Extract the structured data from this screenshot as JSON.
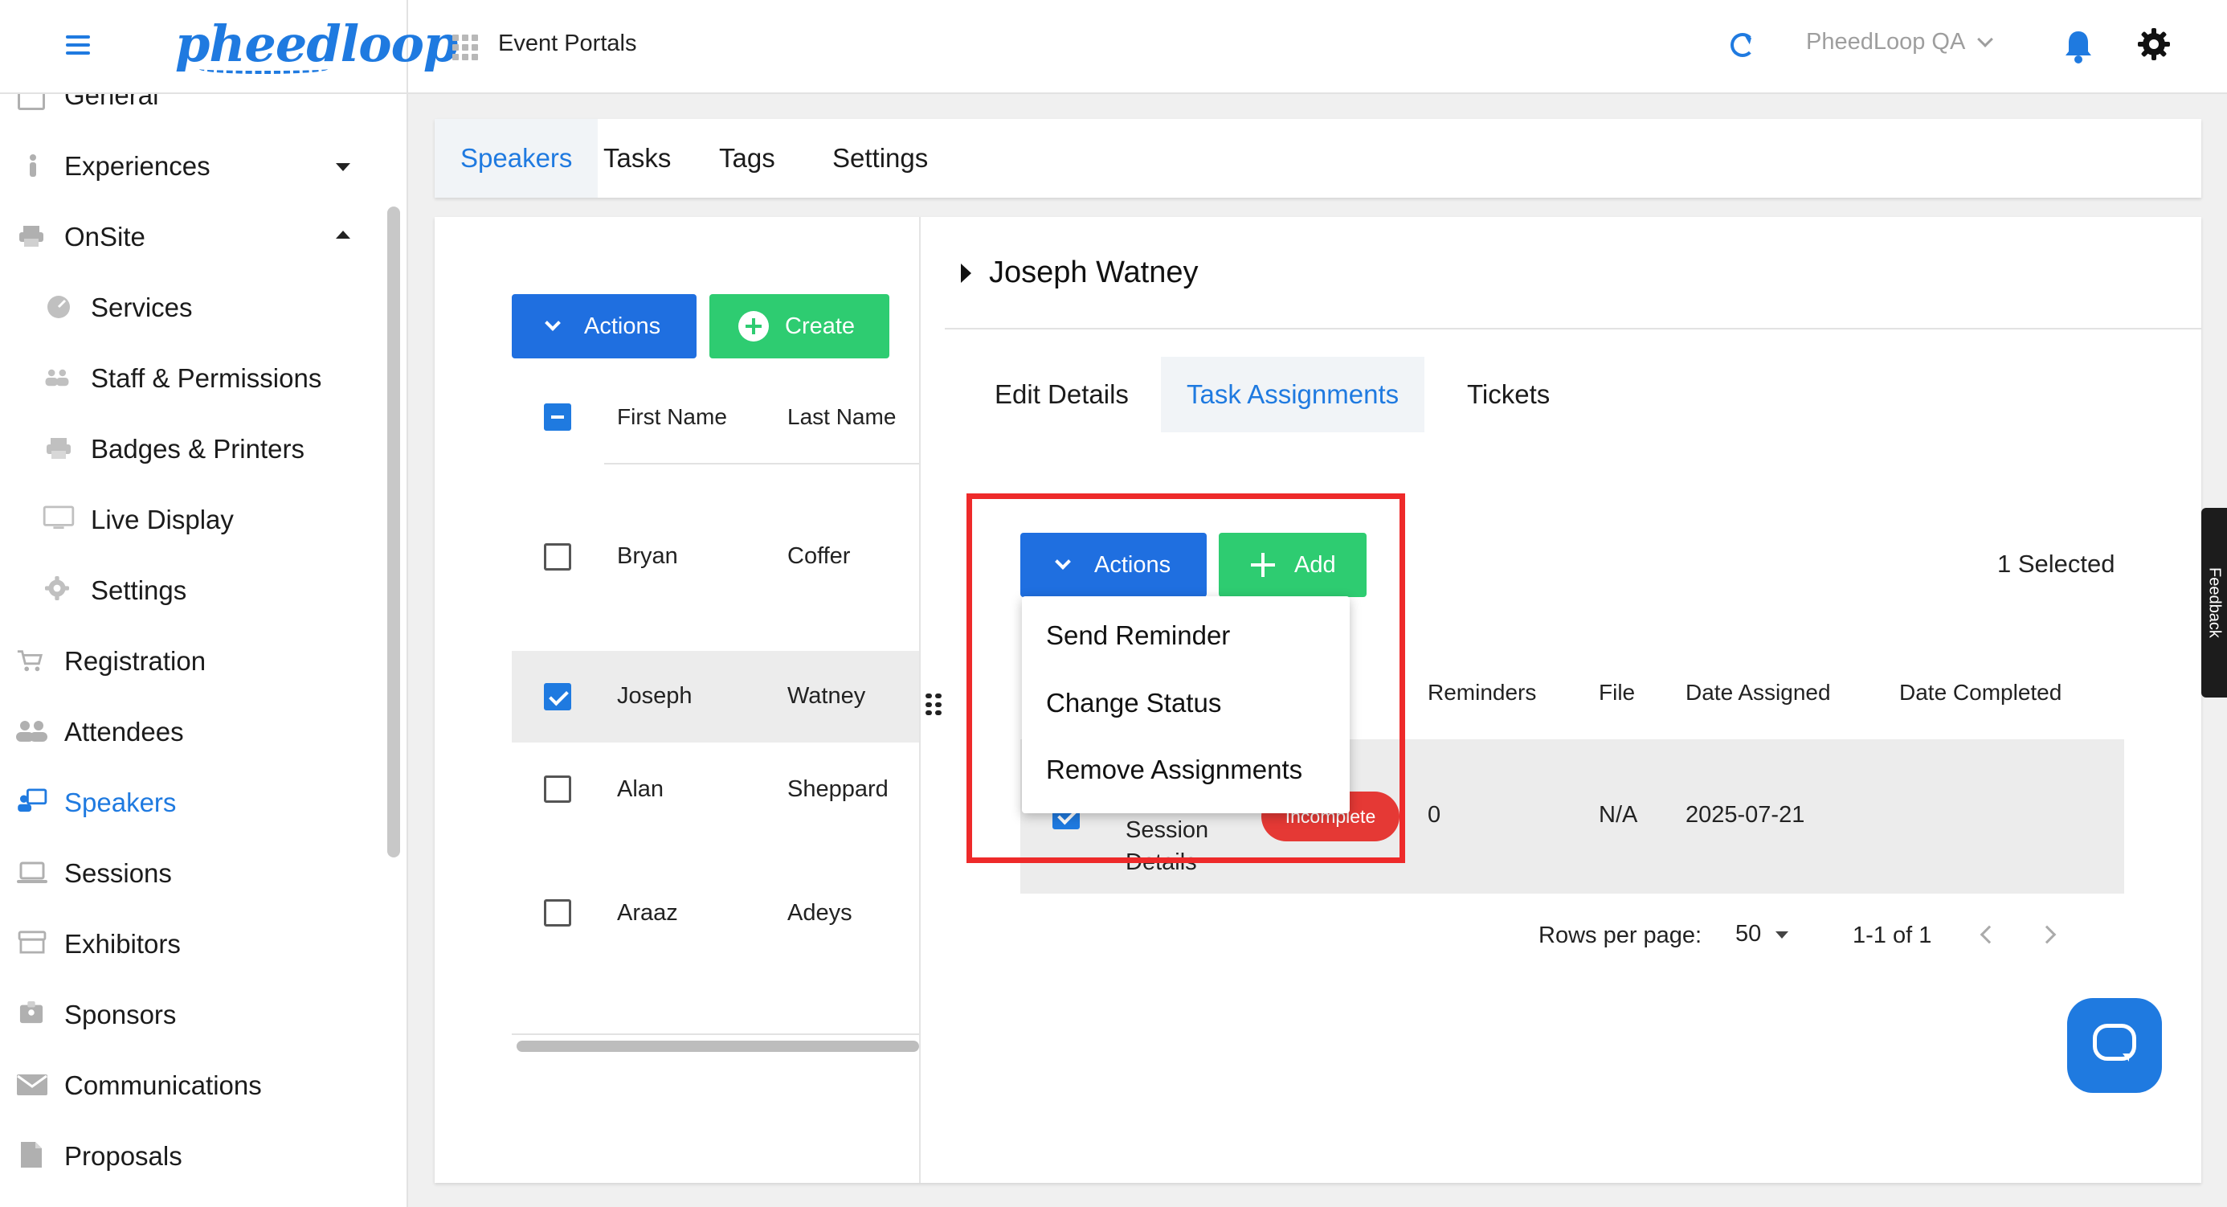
{
  "header": {
    "logo_text": "pheedloop",
    "portal_title": "Event Portals",
    "org_name": "PheedLoop QA"
  },
  "sidebar": {
    "items": [
      {
        "label": "General",
        "icon": "grid-icon"
      },
      {
        "label": "Experiences",
        "icon": "person-icon"
      },
      {
        "label": "OnSite",
        "icon": "printer-icon"
      },
      {
        "label": "Services",
        "icon": "services-icon"
      },
      {
        "label": "Staff & Permissions",
        "icon": "people-icon"
      },
      {
        "label": "Badges & Printers",
        "icon": "printer-icon"
      },
      {
        "label": "Live Display",
        "icon": "monitor-icon"
      },
      {
        "label": "Settings",
        "icon": "gear-icon"
      },
      {
        "label": "Registration",
        "icon": "cart-icon"
      },
      {
        "label": "Attendees",
        "icon": "people-icon"
      },
      {
        "label": "Speakers",
        "icon": "speaker-icon"
      },
      {
        "label": "Sessions",
        "icon": "laptop-icon"
      },
      {
        "label": "Exhibitors",
        "icon": "store-icon"
      },
      {
        "label": "Sponsors",
        "icon": "badge-icon"
      },
      {
        "label": "Communications",
        "icon": "mail-icon"
      },
      {
        "label": "Proposals",
        "icon": "document-icon"
      }
    ]
  },
  "main_tabs": [
    "Speakers",
    "Tasks",
    "Tags",
    "Settings"
  ],
  "speakers_panel": {
    "actions_label": "Actions",
    "create_label": "Create",
    "columns": [
      "First Name",
      "Last Name"
    ],
    "rows": [
      {
        "first": "Bryan",
        "last": "Coffer"
      },
      {
        "first": "Joseph",
        "last": "Watney"
      },
      {
        "first": "Alan",
        "last": "Sheppard"
      },
      {
        "first": "Araaz",
        "last": "Adeys"
      }
    ]
  },
  "detail": {
    "speaker_name": "Joseph Watney",
    "sub_tabs": [
      "Edit Details",
      "Task Assignments",
      "Tickets"
    ],
    "actions_label": "Actions",
    "add_label": "Add",
    "selected_text": "1 Selected",
    "columns": [
      "Reminders",
      "File",
      "Date Assigned",
      "Date Completed"
    ],
    "task_row": {
      "task_line1": "Session",
      "task_line2": "Details",
      "status": "Incomplete",
      "reminders": "0",
      "file": "N/A",
      "date_assigned": "2025-07-21",
      "date_completed": ""
    },
    "actions_menu": [
      "Send Reminder",
      "Change Status",
      "Remove Assignments"
    ],
    "pagination": {
      "rows_per_page_label": "Rows per page:",
      "rows_per_page": "50",
      "range": "1-1 of 1"
    }
  },
  "feedback_label": "Feedback",
  "colors": {
    "primary": "#1f7ae0",
    "success": "#2ecc71",
    "danger": "#e53935",
    "highlight": "#ee2a2a"
  }
}
